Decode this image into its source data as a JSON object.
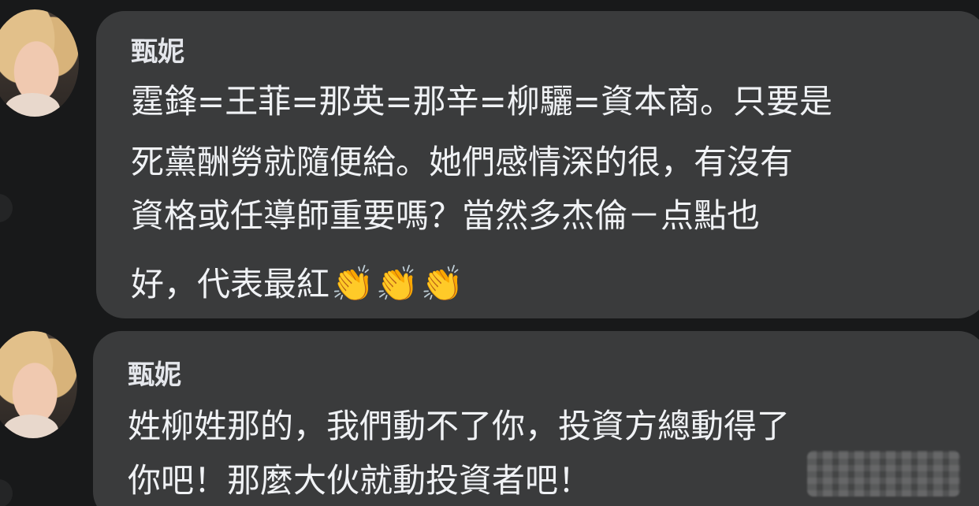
{
  "comments": [
    {
      "author": "甄妮",
      "lines": [
        "霆鋒=王菲=那英=那辛=柳驪=資本商。只要是",
        "死黨酬勞就隨便給。她們感情深的很，有沒有",
        "資格或任導師重要嗎？當然多杰倫－点點也",
        "好，代表最紅"
      ],
      "emoji": [
        "👏",
        "👏",
        "👏"
      ]
    },
    {
      "author": "甄妮",
      "lines": [
        "姓柳姓那的，我們動不了你，投資方總動得了",
        "你吧！那麼大伙就動投資者吧！"
      ]
    }
  ]
}
